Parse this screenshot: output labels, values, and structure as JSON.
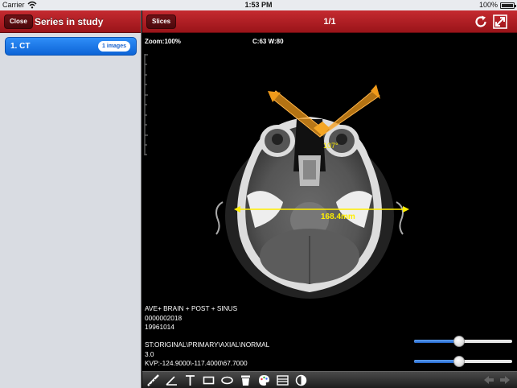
{
  "status_bar": {
    "carrier": "Carrier",
    "time": "1:53 PM",
    "battery": "100%"
  },
  "left_panel": {
    "close_label": "Close",
    "title": "Series in study",
    "series": [
      {
        "label": "1. CT",
        "badge": "1 images"
      }
    ]
  },
  "viewer": {
    "slices_label": "Slices",
    "page_indicator": "1/1",
    "zoom": "Zoom:100%",
    "window": "C:63 W:80",
    "measurements": {
      "angle_label": "107°",
      "distance_label": "168.4mm"
    },
    "info_lines_top": [
      "AVE+ BRAIN + POST + SINUS",
      "0000002018",
      "19961014"
    ],
    "info_lines_bottom": [
      "ST:ORIGINAL\\PRIMARY\\AXIAL\\NORMAL",
      "3.0",
      "KVP:-124.9000\\-117.4000\\67.7000"
    ],
    "sliders": [
      {
        "name": "window-center",
        "value": 0.45
      },
      {
        "name": "window-width",
        "value": 0.45
      }
    ]
  },
  "toolbar": {
    "tools": [
      "ruler-icon",
      "angle-icon",
      "text-icon",
      "rectangle-icon",
      "ellipse-icon",
      "trash-icon",
      "palette-icon",
      "stack-icon",
      "contrast-icon"
    ],
    "nav": [
      "previous-arrow-icon",
      "next-arrow-icon"
    ]
  },
  "colors": {
    "header_red": "#b21f25",
    "selection_blue": "#1a72e6",
    "measure_yellow": "#ffee00",
    "angle_orange": "#f09a1a"
  }
}
